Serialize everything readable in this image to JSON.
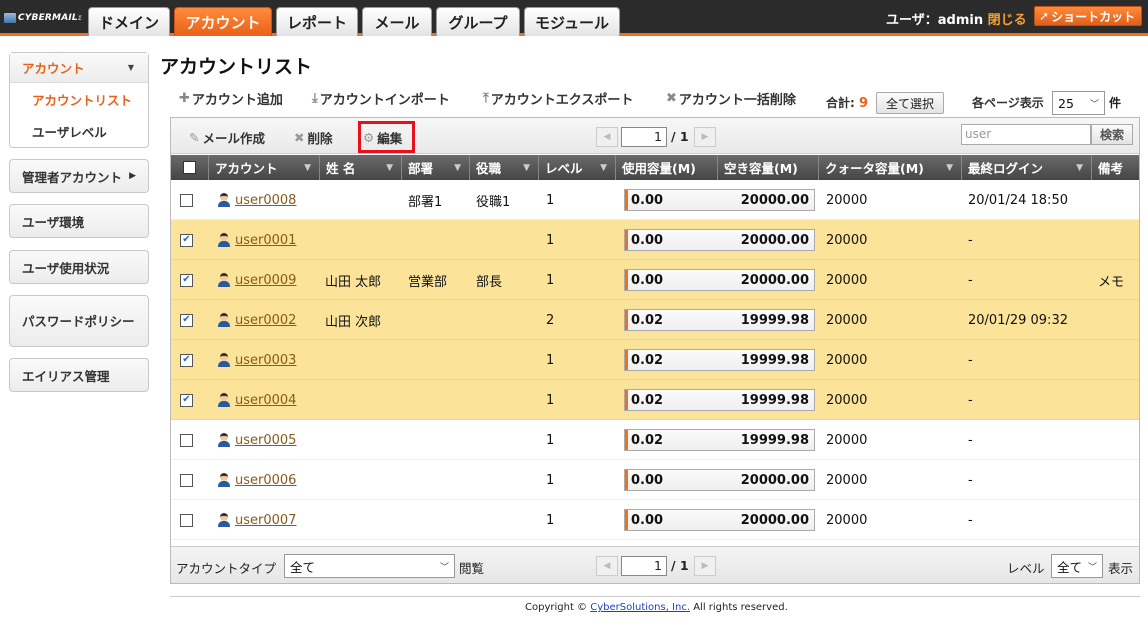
{
  "app": {
    "logo": "CYBERMAIL",
    "logo_sup": "Σ",
    "tabs": [
      "ドメイン",
      "アカウント",
      "レポート",
      "メール",
      "グループ",
      "モジュール"
    ],
    "active_tab": 1,
    "user_label": "ユーザ：admin",
    "logout": "閉じる",
    "shortcut": "ショートカット"
  },
  "sidebar": {
    "account_head": "アカウント",
    "account_items": [
      "アカウントリスト",
      "ユーザレベル"
    ],
    "items": [
      "管理者アカウント",
      "ユーザ環境",
      "ユーザ使用状況",
      "パスワードポリシー",
      "エイリアス管理"
    ]
  },
  "main": {
    "title": "アカウントリスト",
    "actions": [
      "アカウント追加",
      "アカウントインポート",
      "アカウントエクスポート",
      "アカウント一括削除"
    ],
    "total_label": "合計:",
    "total_count": "9",
    "select_all": "全て選択",
    "per_page_label": "各ページ表示",
    "per_page_value": "25",
    "per_page_unit": "件"
  },
  "toolbar": {
    "compose": "メール作成",
    "delete": "削除",
    "edit": "編集",
    "page_current": "1",
    "page_total": "/ 1",
    "search_placeholder": "user",
    "search_button": "検索"
  },
  "columns": [
    "アカウント",
    "姓 名",
    "部署",
    "役職",
    "レベル",
    "使用容量(M)",
    "空き容量(M)",
    "クォータ容量(M)",
    "最終ログイン",
    "備考"
  ],
  "rows": [
    {
      "checked": false,
      "account": "user0008",
      "name": "",
      "dept": "部署1",
      "role": "役職1",
      "level": "1",
      "used": "0.00",
      "free": "20000.00",
      "quota": "20000",
      "last_login": "20/01/24 18:50",
      "note": ""
    },
    {
      "checked": true,
      "account": "user0001",
      "name": "",
      "dept": "",
      "role": "",
      "level": "1",
      "used": "0.00",
      "free": "20000.00",
      "quota": "20000",
      "last_login": "-",
      "note": ""
    },
    {
      "checked": true,
      "account": "user0009",
      "name": "山田 太郎",
      "dept": "営業部",
      "role": "部長",
      "level": "1",
      "used": "0.00",
      "free": "20000.00",
      "quota": "20000",
      "last_login": "-",
      "note": "メモ"
    },
    {
      "checked": true,
      "account": "user0002",
      "name": "山田 次郎",
      "dept": "",
      "role": "",
      "level": "2",
      "used": "0.02",
      "free": "19999.98",
      "quota": "20000",
      "last_login": "20/01/29 09:32",
      "note": ""
    },
    {
      "checked": true,
      "account": "user0003",
      "name": "",
      "dept": "",
      "role": "",
      "level": "1",
      "used": "0.02",
      "free": "19999.98",
      "quota": "20000",
      "last_login": "-",
      "note": ""
    },
    {
      "checked": true,
      "account": "user0004",
      "name": "",
      "dept": "",
      "role": "",
      "level": "1",
      "used": "0.02",
      "free": "19999.98",
      "quota": "20000",
      "last_login": "-",
      "note": ""
    },
    {
      "checked": false,
      "account": "user0005",
      "name": "",
      "dept": "",
      "role": "",
      "level": "1",
      "used": "0.02",
      "free": "19999.98",
      "quota": "20000",
      "last_login": "-",
      "note": ""
    },
    {
      "checked": false,
      "account": "user0006",
      "name": "",
      "dept": "",
      "role": "",
      "level": "1",
      "used": "0.00",
      "free": "20000.00",
      "quota": "20000",
      "last_login": "-",
      "note": ""
    },
    {
      "checked": false,
      "account": "user0007",
      "name": "",
      "dept": "",
      "role": "",
      "level": "1",
      "used": "0.00",
      "free": "20000.00",
      "quota": "20000",
      "last_login": "-",
      "note": ""
    }
  ],
  "footer": {
    "account_type_label": "アカウントタイプ",
    "account_type_value": "全て",
    "view_label": "閲覧",
    "page_current": "1",
    "page_total": "/ 1",
    "level_label": "レベル",
    "level_value": "全て",
    "show_label": "表示"
  },
  "copyright": {
    "prefix": "Copyright © ",
    "link": "CyberSolutions, Inc.",
    "suffix": " All rights reserved."
  },
  "colors": {
    "accent": "#f07020",
    "selected_row": "#fbe39a",
    "highlight_box": "#e8101a"
  }
}
